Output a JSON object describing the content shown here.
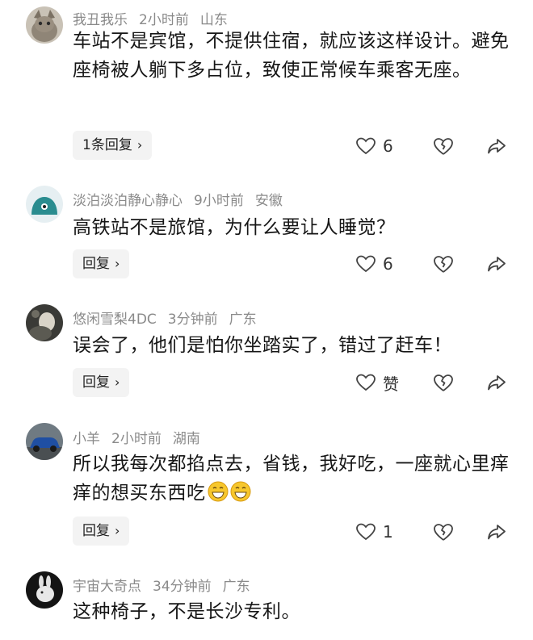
{
  "comments": [
    {
      "username": "我丑我乐",
      "time": "2小时前",
      "location": "山东",
      "content": "车站不是宾馆，不提供住宿，就应该这样设计。避免座椅被人躺下多占位，致使正常候车乘客无座。",
      "reply_label": "1条回复",
      "like_label": "6",
      "avatar_icon": "cat-avatar-icon"
    },
    {
      "username": "淡泊淡泊静心静心",
      "time": "9小时前",
      "location": "安徽",
      "content": "高铁站不是旅馆，为什么要让人睡觉？",
      "reply_label": "回复",
      "like_label": "6",
      "avatar_icon": "teal-cartoon-avatar-icon"
    },
    {
      "username": "悠闲雪梨4DC",
      "time": "3分钟前",
      "location": "广东",
      "content": "误会了，他们是怕你坐踏实了，错过了赶车！",
      "reply_label": "回复",
      "like_label": "赞",
      "avatar_icon": "dark-photo-avatar-icon"
    },
    {
      "username": "小羊",
      "time": "2小时前",
      "location": "湖南",
      "content": "所以我每次都掐点去，省钱，我好吃，一座就心里痒痒的想买东西吃",
      "reply_label": "回复",
      "like_label": "1",
      "avatar_icon": "blue-car-avatar-icon"
    },
    {
      "username": "宇宙大奇点",
      "time": "34分钟前",
      "location": "广东",
      "content": "这种椅子，不是长沙专利。",
      "avatar_icon": "white-rabbit-avatar-icon"
    }
  ]
}
